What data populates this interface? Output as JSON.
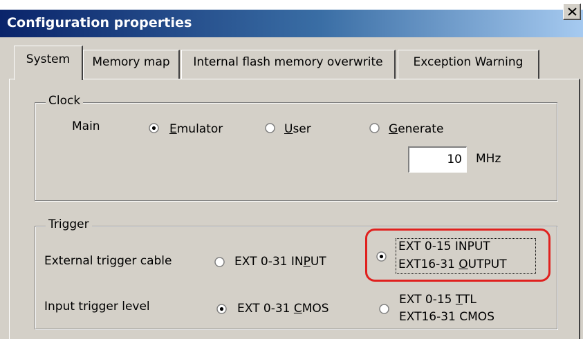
{
  "window": {
    "title": "Configuration properties",
    "close_label": "close"
  },
  "tabs": [
    {
      "label": "System",
      "active": true
    },
    {
      "label": "Memory map",
      "active": false
    },
    {
      "label": "Internal flash memory overwrite",
      "active": false
    },
    {
      "label": "Exception Warning",
      "active": false
    }
  ],
  "clock": {
    "group_label": "Clock",
    "main_label": "Main",
    "options": [
      {
        "pre": "",
        "accel": "E",
        "post": "mulator",
        "selected": true
      },
      {
        "pre": "",
        "accel": "U",
        "post": "ser",
        "selected": false
      },
      {
        "pre": "",
        "accel": "G",
        "post": "enerate",
        "selected": false
      }
    ],
    "frequency_value": "10",
    "frequency_unit": "MHz"
  },
  "trigger": {
    "group_label": "Trigger",
    "cable_label": "External trigger cable",
    "cable_options": [
      {
        "line1_pre": "EXT 0-31  IN",
        "line1_accel": "P",
        "line1_post": "UT",
        "selected": false
      },
      {
        "line1": "EXT 0-15  INPUT",
        "line2_pre": "EXT16-31  ",
        "line2_accel": "O",
        "line2_post": "UTPUT",
        "selected": true
      }
    ],
    "level_label": "Input trigger level",
    "level_options": [
      {
        "line1_pre": "EXT 0-31  ",
        "line1_accel": "C",
        "line1_post": "MOS",
        "selected": true
      },
      {
        "line1_pre": "EXT 0-15  ",
        "line1_accel": "T",
        "line1_post": "TL",
        "line2": "EXT16-31  CMOS",
        "selected": false
      }
    ]
  },
  "colors": {
    "title_gradient_start": "#0a246a",
    "title_gradient_end": "#a6caf0",
    "face": "#d4d0c8",
    "highlight_ring": "#e0201e"
  }
}
